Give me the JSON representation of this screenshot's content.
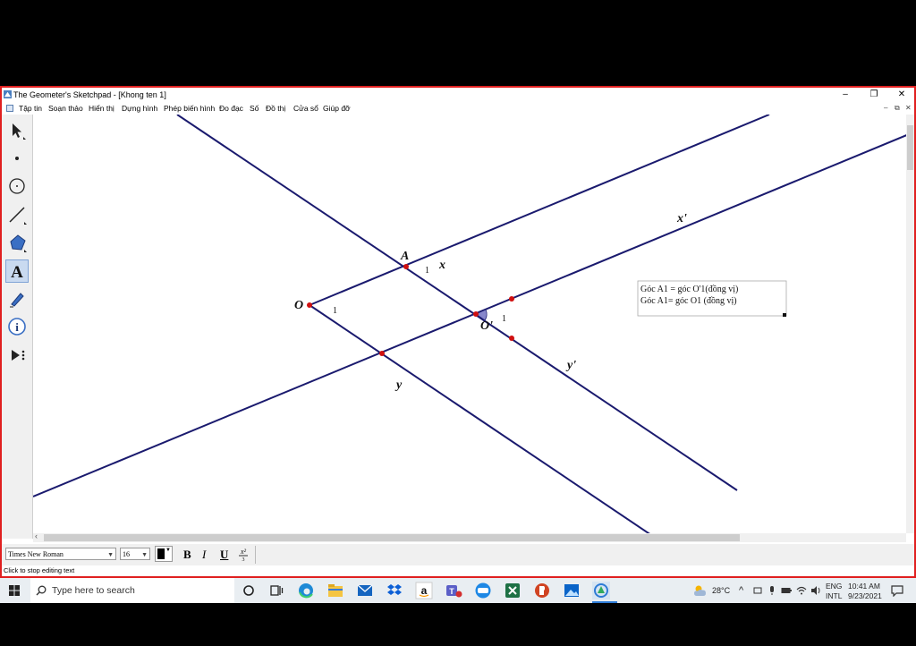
{
  "window": {
    "title": "The Geometer's Sketchpad - [Khong ten 1]",
    "min": "–",
    "max": "❐",
    "close": "✕",
    "doc_min": "–",
    "doc_restore": "⧉",
    "doc_close": "✕"
  },
  "menu": [
    "Tập tin",
    "Soạn thảo",
    "Hiển thị",
    "Dựng hình",
    "Phép biến hình",
    "Đo đạc",
    "Số",
    "Đồ thị",
    "Cửa sổ",
    "Giúp đỡ"
  ],
  "tools": [
    "arrow-select-icon",
    "point-icon",
    "compass-icon",
    "straightedge-icon",
    "polygon-icon",
    "text-icon",
    "marker-icon",
    "information-icon",
    "custom-tool-icon"
  ],
  "sketch": {
    "labels": {
      "A": "A",
      "O": "O",
      "O_prime": "O'",
      "x": "x",
      "x_prime": "x'",
      "y": "y",
      "y_prime": "y'",
      "angle_A": "1",
      "angle_O": "1",
      "angle_Oprime": "1"
    },
    "note": [
      "Góc A1 = góc O'1(đồng vị)",
      "Góc A1= góc O1 (đồng vị)"
    ],
    "line_color": "#1a1a6e",
    "point_color": "#d01010",
    "angle_mark_color": "#8888cc"
  },
  "textbar": {
    "font": "Times New Roman",
    "size": "16",
    "bold": "B",
    "italic": "I",
    "underline": "U"
  },
  "status": "Click to stop editing text",
  "taskbar": {
    "search_placeholder": "Type here to search",
    "weather": "28°C",
    "lang1": "ENG",
    "lang2": "INTL",
    "time": "10:41 AM",
    "date": "9/23/2021"
  },
  "colors": {
    "window_border": "#e02020"
  }
}
